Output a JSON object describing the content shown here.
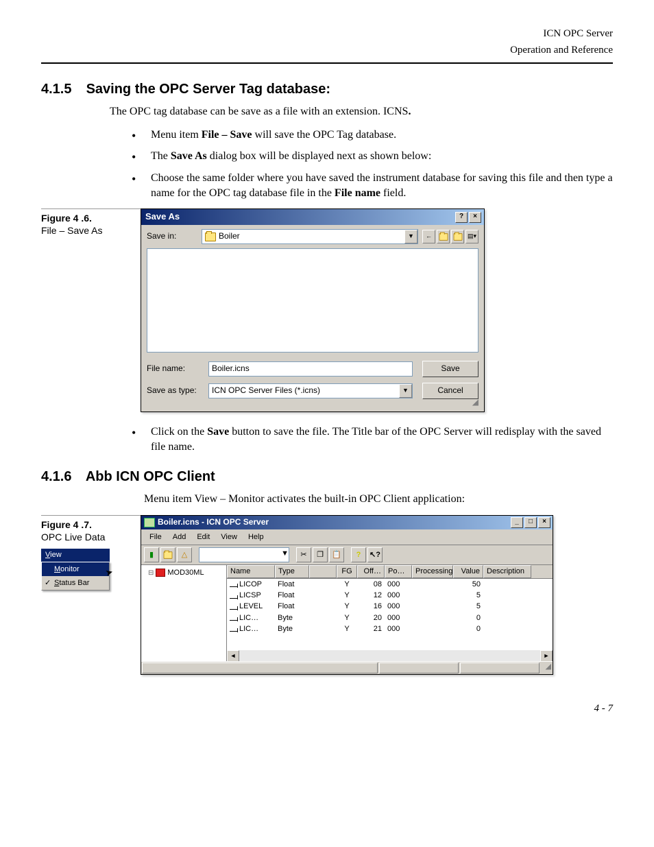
{
  "header": {
    "product": "ICN OPC Server",
    "section": "Operation and Reference"
  },
  "sec415": {
    "num": "4.1.5",
    "title": "Saving the OPC Server Tag database:",
    "intro_a": "The OPC tag database can be save as a file with an extension. ICNS",
    "intro_b": ".",
    "bullet1_a": "Menu item ",
    "bullet1_b": "File – Save",
    "bullet1_c": " will save the OPC Tag database.",
    "bullet2_a": "The ",
    "bullet2_b": "Save As",
    "bullet2_c": " dialog box will be displayed next as shown below:",
    "bullet3_a": "Choose the same folder where you have saved the instrument database for saving this file and then type a name for the OPC tag database file in the ",
    "bullet3_b": "File name",
    "bullet3_c": " field.",
    "bullet4_a": "Click on the ",
    "bullet4_b": "Save",
    "bullet4_c": " button to save the file. The Title bar of the OPC Server will redisplay with the saved file name."
  },
  "fig46": {
    "label_bold": "Figure 4 .6.",
    "label_sub": "File – Save As"
  },
  "saveas": {
    "title": "Save As",
    "help_btn": "?",
    "close_btn": "×",
    "savein_label": "Save in:",
    "savein_value": "Boiler",
    "filename_label": "File name:",
    "filename_value": "Boiler.icns",
    "savetype_label": "Save as type:",
    "savetype_value": "ICN OPC Server Files (*.icns)",
    "save_btn": "Save",
    "cancel_btn": "Cancel"
  },
  "sec416": {
    "num": "4.1.6",
    "title": "Abb ICN OPC Client",
    "intro": "Menu item View – Monitor activates the built-in OPC Client application:"
  },
  "fig47": {
    "label_bold": "Figure 4 .7.",
    "label_sub": "OPC Live Data"
  },
  "viewmenu": {
    "view": "View",
    "monitor": "Monitor",
    "statusbar": "Status Bar",
    "check": "✓"
  },
  "opc": {
    "title": "Boiler.icns - ICN OPC Server",
    "min": "_",
    "max": "□",
    "close": "×",
    "menu": {
      "file": "File",
      "add": "Add",
      "edit": "Edit",
      "view": "View",
      "help": "Help"
    },
    "tree_node": "MOD30ML",
    "columns": {
      "name": "Name",
      "type": "Type",
      "fg": "FG",
      "off": "Off…",
      "po": "Po…",
      "proc": "Processing",
      "val": "Value",
      "desc": "Description"
    },
    "rows": [
      {
        "name": "LICOP",
        "type": "Float",
        "fg": "Y",
        "off": "08",
        "po": "000",
        "val": "50"
      },
      {
        "name": "LICSP",
        "type": "Float",
        "fg": "Y",
        "off": "12",
        "po": "000",
        "val": "5"
      },
      {
        "name": "LEVEL",
        "type": "Float",
        "fg": "Y",
        "off": "16",
        "po": "000",
        "val": "5"
      },
      {
        "name": "LIC…",
        "type": "Byte",
        "fg": "Y",
        "off": "20",
        "po": "000",
        "val": "0"
      },
      {
        "name": "LIC…",
        "type": "Byte",
        "fg": "Y",
        "off": "21",
        "po": "000",
        "val": "0"
      }
    ],
    "sb_left": "◄",
    "sb_right": "►"
  },
  "page_num": "4 - 7"
}
